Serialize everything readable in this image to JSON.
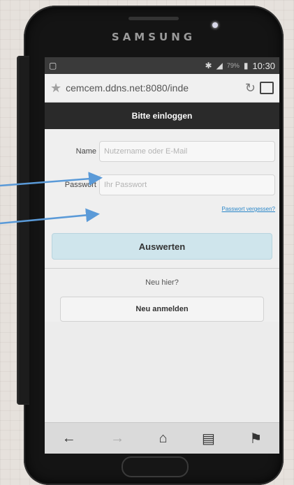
{
  "device": {
    "brand": "SAMSUNG"
  },
  "statusbar": {
    "battery": "79%",
    "time": "10:30"
  },
  "browser": {
    "url": "cemcem.ddns.net:8080/inde"
  },
  "page": {
    "header": "Bitte einloggen",
    "name_label": "Name",
    "name_placeholder": "Nutzername oder E-Mail",
    "password_label": "Passwort",
    "password_placeholder": "Ihr Passwort",
    "forgot_link": "Passwort vergessen?",
    "submit_button": "Auswerten",
    "new_here": "Neu hier?",
    "signup_button": "Neu anmelden"
  },
  "icons": {
    "star": "star-icon",
    "reload": "reload-icon",
    "tabs": "tabs-icon",
    "back": "back-icon",
    "forward": "forward-icon",
    "home": "home-icon",
    "bookmarks": "bookmarks-icon",
    "saved": "saved-pages-icon"
  },
  "colors": {
    "link": "#2a86c8",
    "primary_button": "#cfe5ec",
    "annotation_arrow": "#5a9ad8"
  }
}
